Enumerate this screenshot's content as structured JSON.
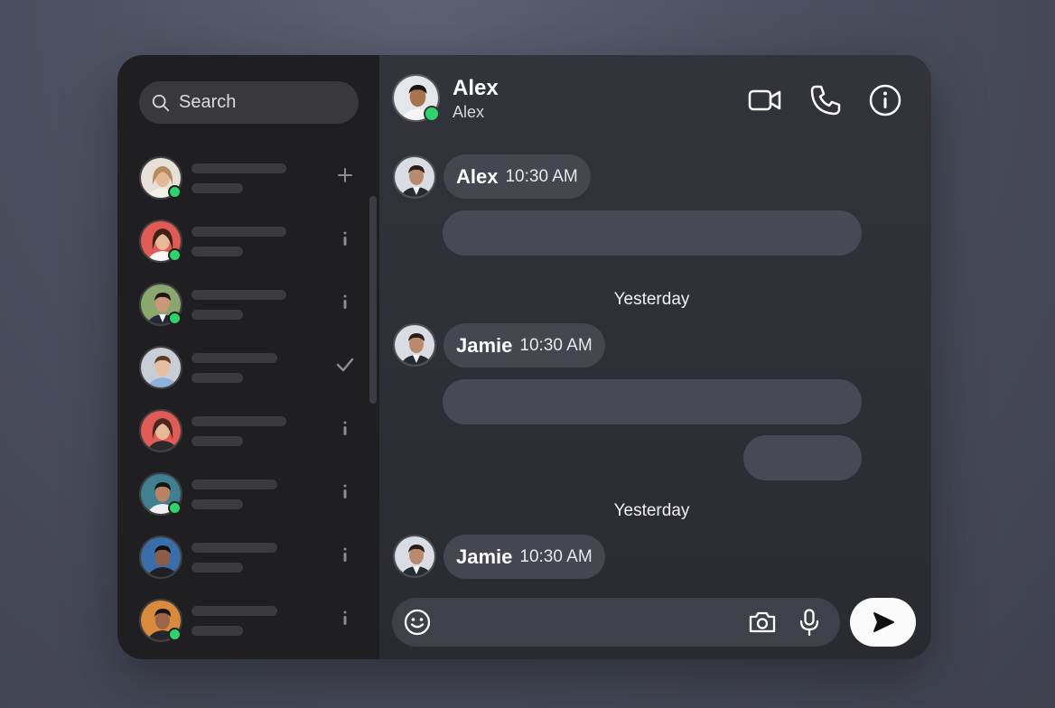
{
  "sidebar": {
    "search": {
      "placeholder": "Search"
    },
    "contacts": [
      {
        "online": true,
        "action": "plus"
      },
      {
        "online": true,
        "action": "info"
      },
      {
        "online": true,
        "action": "info"
      },
      {
        "online": false,
        "action": "check"
      },
      {
        "online": false,
        "action": "info"
      },
      {
        "online": true,
        "action": "info"
      },
      {
        "online": false,
        "action": "info"
      },
      {
        "online": true,
        "action": "info"
      }
    ]
  },
  "chat": {
    "header": {
      "name": "Alex",
      "subtitle": "Alex",
      "online": true
    },
    "messages": [
      {
        "sender": "Alex",
        "time": "10:30 AM"
      },
      {
        "sender": "Jamie",
        "time": "10:30 AM"
      },
      {
        "sender": "Jamie",
        "time": "10:30 AM"
      }
    ],
    "day_separators": [
      "Yesterday",
      "Yesterday"
    ]
  },
  "colors": {
    "online": "#2fd36b",
    "sidebar": "#1f1f22",
    "panel": "#33343b",
    "bubble": "#484955"
  },
  "icons": [
    "search-icon",
    "plus-icon",
    "info-icon",
    "check-icon",
    "video-camera-icon",
    "phone-icon",
    "info-circle-icon",
    "emoji-icon",
    "camera-icon",
    "microphone-icon",
    "send-icon"
  ]
}
